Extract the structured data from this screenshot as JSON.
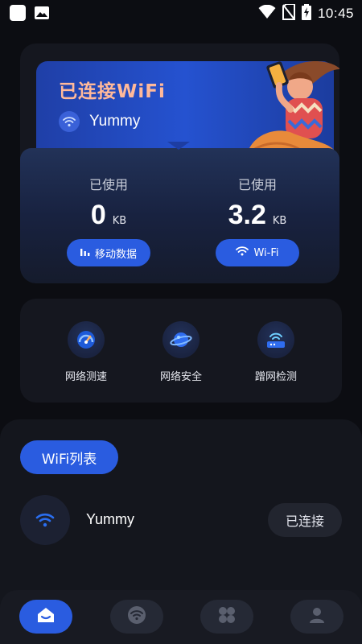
{
  "status_bar": {
    "time": "10:45",
    "left_icons": [
      "square-icon",
      "image-icon"
    ],
    "right_icons": [
      "wifi-signal-icon",
      "no-sim-icon",
      "battery-charging-icon"
    ]
  },
  "connection": {
    "title": "已连接WiFi",
    "ssid": "Yummy",
    "illustration": "person-holding-phone-illustration"
  },
  "usage": {
    "mobile": {
      "label": "已使用",
      "value": "0",
      "unit": "KB",
      "button": "移动数据"
    },
    "wifi": {
      "label": "已使用",
      "value": "3.2",
      "unit": "KB",
      "button": "Wi-Fi"
    }
  },
  "tools": [
    {
      "label": "网络测速",
      "icon": "speedometer-icon"
    },
    {
      "label": "网络安全",
      "icon": "planet-shield-icon"
    },
    {
      "label": "蹭网检测",
      "icon": "router-icon"
    }
  ],
  "wifi_list": {
    "tab_label": "WiFi列表",
    "networks": [
      {
        "name": "Yummy",
        "status": "已连接"
      }
    ]
  },
  "bottom_nav": [
    {
      "name": "home",
      "icon": "home-icon",
      "active": true
    },
    {
      "name": "wifi",
      "icon": "wifi-icon",
      "active": false
    },
    {
      "name": "tools",
      "icon": "grid-icon",
      "active": false
    },
    {
      "name": "profile",
      "icon": "user-icon",
      "active": false
    }
  ],
  "colors": {
    "background": "#0c0d12",
    "accent": "#2a5ce0",
    "banner_title": "#ffb99a"
  }
}
